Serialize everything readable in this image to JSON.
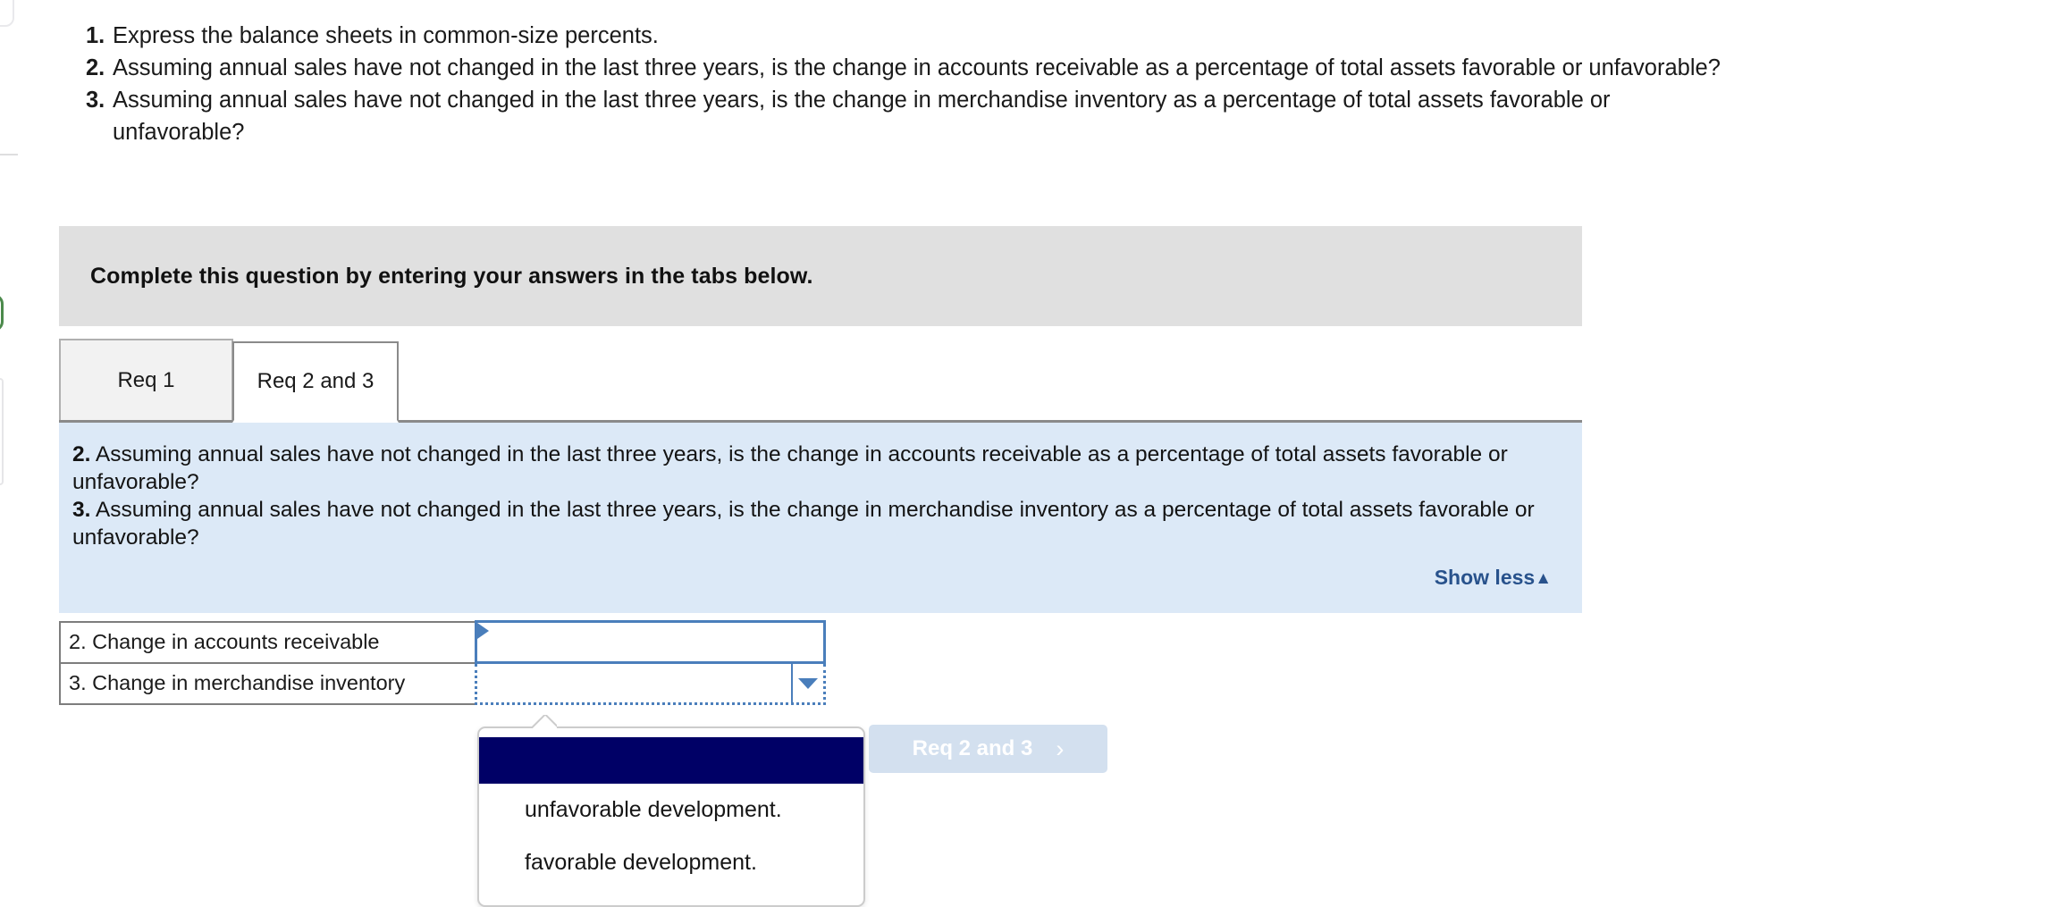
{
  "requirements": [
    {
      "num": "1.",
      "text": "Express the balance sheets in common-size percents."
    },
    {
      "num": "2.",
      "text": "Assuming annual sales have not changed in the last three years, is the change in accounts receivable as a percentage of total assets favorable or unfavorable?"
    },
    {
      "num": "3.",
      "text": "Assuming annual sales have not changed in the last three years, is the change in merchandise inventory as a percentage of total assets favorable or unfavorable?"
    }
  ],
  "banner": {
    "instruction": "Complete this question by entering your answers in the tabs below."
  },
  "tabs": [
    {
      "label": "Req 1",
      "active": false
    },
    {
      "label": "Req 2 and 3",
      "active": true
    }
  ],
  "info_panel": {
    "line1_num": "2.",
    "line1_text": " Assuming annual sales have not changed in the last three years, is the change in accounts receivable as a percentage of total assets favorable or unfavorable?",
    "line2_num": "3.",
    "line2_text": " Assuming annual sales have not changed in the last three years, is the change in merchandise inventory as a percentage of total assets favorable or unfavorable?",
    "show_less_label": "Show less",
    "show_less_caret": "▲",
    "background_color": "#dce9f7",
    "link_color": "#28528c"
  },
  "answer_table": {
    "rows": [
      {
        "label": "2. Change in accounts receivable",
        "value": "",
        "state": "active-cell"
      },
      {
        "label": "3. Change in merchandise inventory",
        "value": "",
        "state": "dropdown-open"
      }
    ]
  },
  "nav_button": {
    "label": "Req 2 and 3",
    "caret": "›",
    "background_color": "#d3e0ef",
    "text_color": "#ffffff"
  },
  "dropdown": {
    "options": [
      {
        "label": "",
        "selected": true,
        "highlight_color": "#000066"
      },
      {
        "label": "unfavorable development.",
        "selected": false
      },
      {
        "label": "favorable development.",
        "selected": false
      }
    ]
  }
}
